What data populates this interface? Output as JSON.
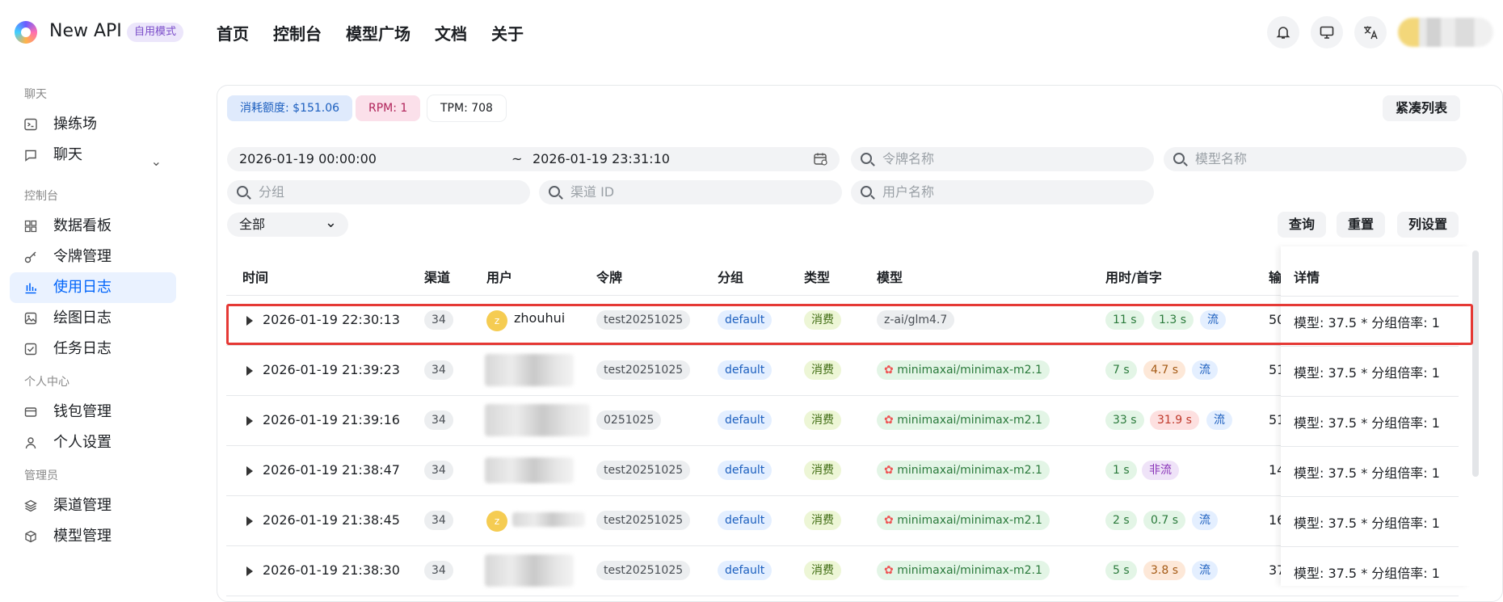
{
  "app": {
    "name": "New API",
    "mode_badge": "自用模式"
  },
  "nav": [
    "首页",
    "控制台",
    "模型广场",
    "文档",
    "关于"
  ],
  "sidebar": {
    "groups": [
      {
        "title": "聊天",
        "items": [
          {
            "label": "操练场",
            "icon": "terminal-icon"
          },
          {
            "label": "聊天",
            "icon": "chat-icon"
          }
        ]
      },
      {
        "title": "控制台",
        "items": [
          {
            "label": "数据看板",
            "icon": "dashboard-icon"
          },
          {
            "label": "令牌管理",
            "icon": "key-icon"
          },
          {
            "label": "使用日志",
            "icon": "bar-chart-icon"
          },
          {
            "label": "绘图日志",
            "icon": "image-icon"
          },
          {
            "label": "任务日志",
            "icon": "checkbox-icon"
          }
        ]
      },
      {
        "title": "个人中心",
        "items": [
          {
            "label": "钱包管理",
            "icon": "wallet-icon"
          },
          {
            "label": "个人设置",
            "icon": "user-icon"
          }
        ]
      },
      {
        "title": "管理员",
        "items": [
          {
            "label": "渠道管理",
            "icon": "layers-icon"
          },
          {
            "label": "模型管理",
            "icon": "box-icon"
          }
        ]
      }
    ],
    "active": "使用日志"
  },
  "stats": {
    "quota": "消耗额度: $151.06",
    "rpm": "RPM: 1",
    "tpm": "TPM: 708"
  },
  "compact_button": "紧凑列表",
  "filters": {
    "date_start": "2026-01-19 00:00:00",
    "date_sep": "~",
    "date_end": "2026-01-19 23:31:10",
    "token_placeholder": "令牌名称",
    "model_placeholder": "模型名称",
    "group_placeholder": "分组",
    "channel_placeholder": "渠道 ID",
    "user_placeholder": "用户名称",
    "type_select": "全部"
  },
  "actions": {
    "query": "查询",
    "reset": "重置",
    "columns": "列设置"
  },
  "columns": [
    "时间",
    "渠道",
    "用户",
    "令牌",
    "分组",
    "类型",
    "模型",
    "用时/首字",
    "输",
    "详情"
  ],
  "rows": [
    {
      "time": "2026-01-19 22:30:13",
      "channel": "34",
      "user": "zhouhui",
      "avatar": "z",
      "token": "test20251025",
      "group": "default",
      "type": "消费",
      "model": "z-ai/glm4.7",
      "use_time": "11 s",
      "first": "1.3 s",
      "stream": "流",
      "input": "50",
      "detail": "模型: 37.5 * 分组倍率: 1"
    },
    {
      "time": "2026-01-19 21:39:23",
      "channel": "34",
      "user": "",
      "avatar": "",
      "token": "test20251025",
      "group": "default",
      "type": "消费",
      "model": "minimaxai/minimax-m2.1",
      "use_time": "7 s",
      "first": "4.7 s",
      "stream": "流",
      "input": "51",
      "detail": "模型: 37.5 * 分组倍率: 1"
    },
    {
      "time": "2026-01-19 21:39:16",
      "channel": "34",
      "user": "",
      "avatar": "",
      "token": "0251025",
      "group": "default",
      "type": "消费",
      "model": "minimaxai/minimax-m2.1",
      "use_time": "33 s",
      "first": "31.9 s",
      "stream": "流",
      "input": "51",
      "detail": "模型: 37.5 * 分组倍率: 1"
    },
    {
      "time": "2026-01-19 21:38:47",
      "channel": "34",
      "user": "",
      "avatar": "",
      "token": "test20251025",
      "group": "default",
      "type": "消费",
      "model": "minimaxai/minimax-m2.1",
      "use_time": "1 s",
      "first": "",
      "stream": "非流",
      "input": "14",
      "detail": "模型: 37.5 * 分组倍率: 1"
    },
    {
      "time": "2026-01-19 21:38:45",
      "channel": "34",
      "user": "",
      "avatar": "z",
      "token": "test20251025",
      "group": "default",
      "type": "消费",
      "model": "minimaxai/minimax-m2.1",
      "use_time": "2 s",
      "first": "0.7 s",
      "stream": "流",
      "input": "16",
      "detail": "模型: 37.5 * 分组倍率: 1"
    },
    {
      "time": "2026-01-19 21:38:30",
      "channel": "34",
      "user": "",
      "avatar": "",
      "token": "test20251025",
      "group": "default",
      "type": "消费",
      "model": "minimaxai/minimax-m2.1",
      "use_time": "5 s",
      "first": "3.8 s",
      "stream": "流",
      "input": "37",
      "detail": "模型: 37.5 * 分组倍率: 1"
    }
  ]
}
